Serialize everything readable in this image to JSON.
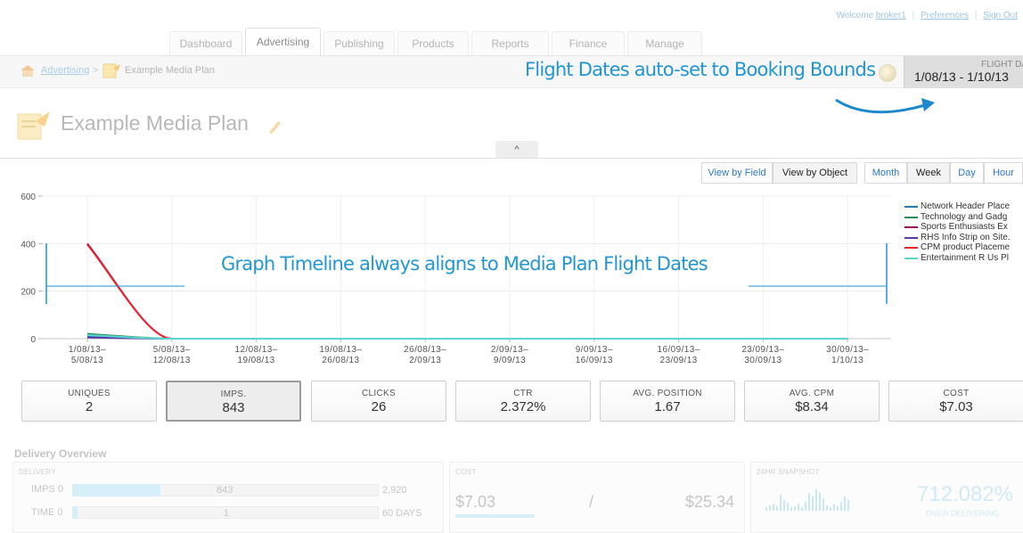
{
  "header": {
    "welcome_prefix": "Welcome",
    "username": "broker1",
    "preferences": "Preferences",
    "sign_out": "Sign Out"
  },
  "tabs": [
    {
      "label": "Dashboard",
      "active": false
    },
    {
      "label": "Advertising",
      "active": true
    },
    {
      "label": "Publishing",
      "active": false
    },
    {
      "label": "Products",
      "active": false
    },
    {
      "label": "Reports",
      "active": false
    },
    {
      "label": "Finance",
      "active": false
    },
    {
      "label": "Manage",
      "active": false
    }
  ],
  "breadcrumb": {
    "link": "Advertising",
    "separator": ">",
    "current": "Example Media Plan"
  },
  "annotations": {
    "flight_dates": "Flight Dates auto-set to Booking Bounds",
    "timeline": "Graph Timeline always aligns to Media Plan Flight Dates"
  },
  "flight": {
    "label": "FLIGHT DATES",
    "range": "1/08/13 - 1/10/13"
  },
  "plan": {
    "title": "Example Media Plan",
    "collapse_glyph": "^"
  },
  "view_toggle": {
    "by_field": "View by Field",
    "by_object": "View by Object",
    "selected": "View by Object"
  },
  "granularity": {
    "month": "Month",
    "week": "Week",
    "day": "Day",
    "hour": "Hour",
    "selected": "Week"
  },
  "chart_data": {
    "type": "line",
    "categories": [
      [
        "1/08/13–",
        "5/08/13"
      ],
      [
        "5/08/13–",
        "12/08/13"
      ],
      [
        "12/08/13–",
        "19/08/13"
      ],
      [
        "19/08/13–",
        "26/08/13"
      ],
      [
        "26/08/13–",
        "2/09/13"
      ],
      [
        "2/09/13–",
        "9/09/13"
      ],
      [
        "9/09/13–",
        "16/09/13"
      ],
      [
        "16/09/13–",
        "23/09/13"
      ],
      [
        "23/09/13–",
        "30/09/13"
      ],
      [
        "30/09/13–",
        "1/10/13"
      ]
    ],
    "yticks": [
      0,
      200,
      400,
      600
    ],
    "ylim": [
      0,
      600
    ],
    "grid": true,
    "legend_position": "right",
    "series": [
      {
        "name": "Network Header Place",
        "color": "#1f78c8",
        "values": [
          8,
          0,
          0,
          0,
          0,
          0,
          0,
          0,
          0,
          0
        ]
      },
      {
        "name": "Technology and Gadg",
        "color": "#2e8b57",
        "values": [
          20,
          0,
          0,
          0,
          0,
          0,
          0,
          0,
          0,
          0
        ]
      },
      {
        "name": "Sports Enthusiasts Ex",
        "color": "#a0005a",
        "values": [
          400,
          0,
          0,
          0,
          0,
          0,
          0,
          0,
          0,
          0
        ]
      },
      {
        "name": "RHS Info Strip on Site.",
        "color": "#5b3aa6",
        "values": [
          5,
          0,
          0,
          0,
          0,
          0,
          0,
          0,
          0,
          0
        ]
      },
      {
        "name": "CPM product Placeme",
        "color": "#e8262c",
        "values": [
          396,
          0,
          0,
          0,
          0,
          0,
          0,
          0,
          0,
          0
        ]
      },
      {
        "name": "Entertainment R Us Pl",
        "color": "#5ad6d0",
        "values": [
          15,
          0,
          0,
          0,
          0,
          0,
          0,
          0,
          0,
          0
        ]
      }
    ]
  },
  "metrics": [
    {
      "label": "UNIQUES",
      "value": "2",
      "selected": false
    },
    {
      "label": "IMPS.",
      "value": "843",
      "selected": true
    },
    {
      "label": "CLICKS",
      "value": "26",
      "selected": false
    },
    {
      "label": "CTR",
      "value": "2.372%",
      "selected": false
    },
    {
      "label": "AVG. POSITION",
      "value": "1.67",
      "selected": false
    },
    {
      "label": "AVG. CPM",
      "value": "$8.34",
      "selected": false
    },
    {
      "label": "COST",
      "value": "$7.03",
      "selected": false
    }
  ],
  "delivery_overview": {
    "title": "Delivery Overview",
    "delivery": {
      "label": "DELIVERY",
      "imps": {
        "label": "IMPS",
        "min": "0",
        "current": "843",
        "max": "2,920",
        "fraction": 0.289
      },
      "time": {
        "label": "TIME",
        "min": "0",
        "current": "1",
        "max": "60 DAYS",
        "fraction": 0.017
      }
    },
    "cost": {
      "label": "COST",
      "spent": "$7.03",
      "separator": "/",
      "budget": "$25.34",
      "fraction": 0.277
    },
    "snapshot": {
      "label": "24HR SNAPSHOT",
      "percent": "712.082%",
      "status": "OVER DELIVERING"
    }
  }
}
